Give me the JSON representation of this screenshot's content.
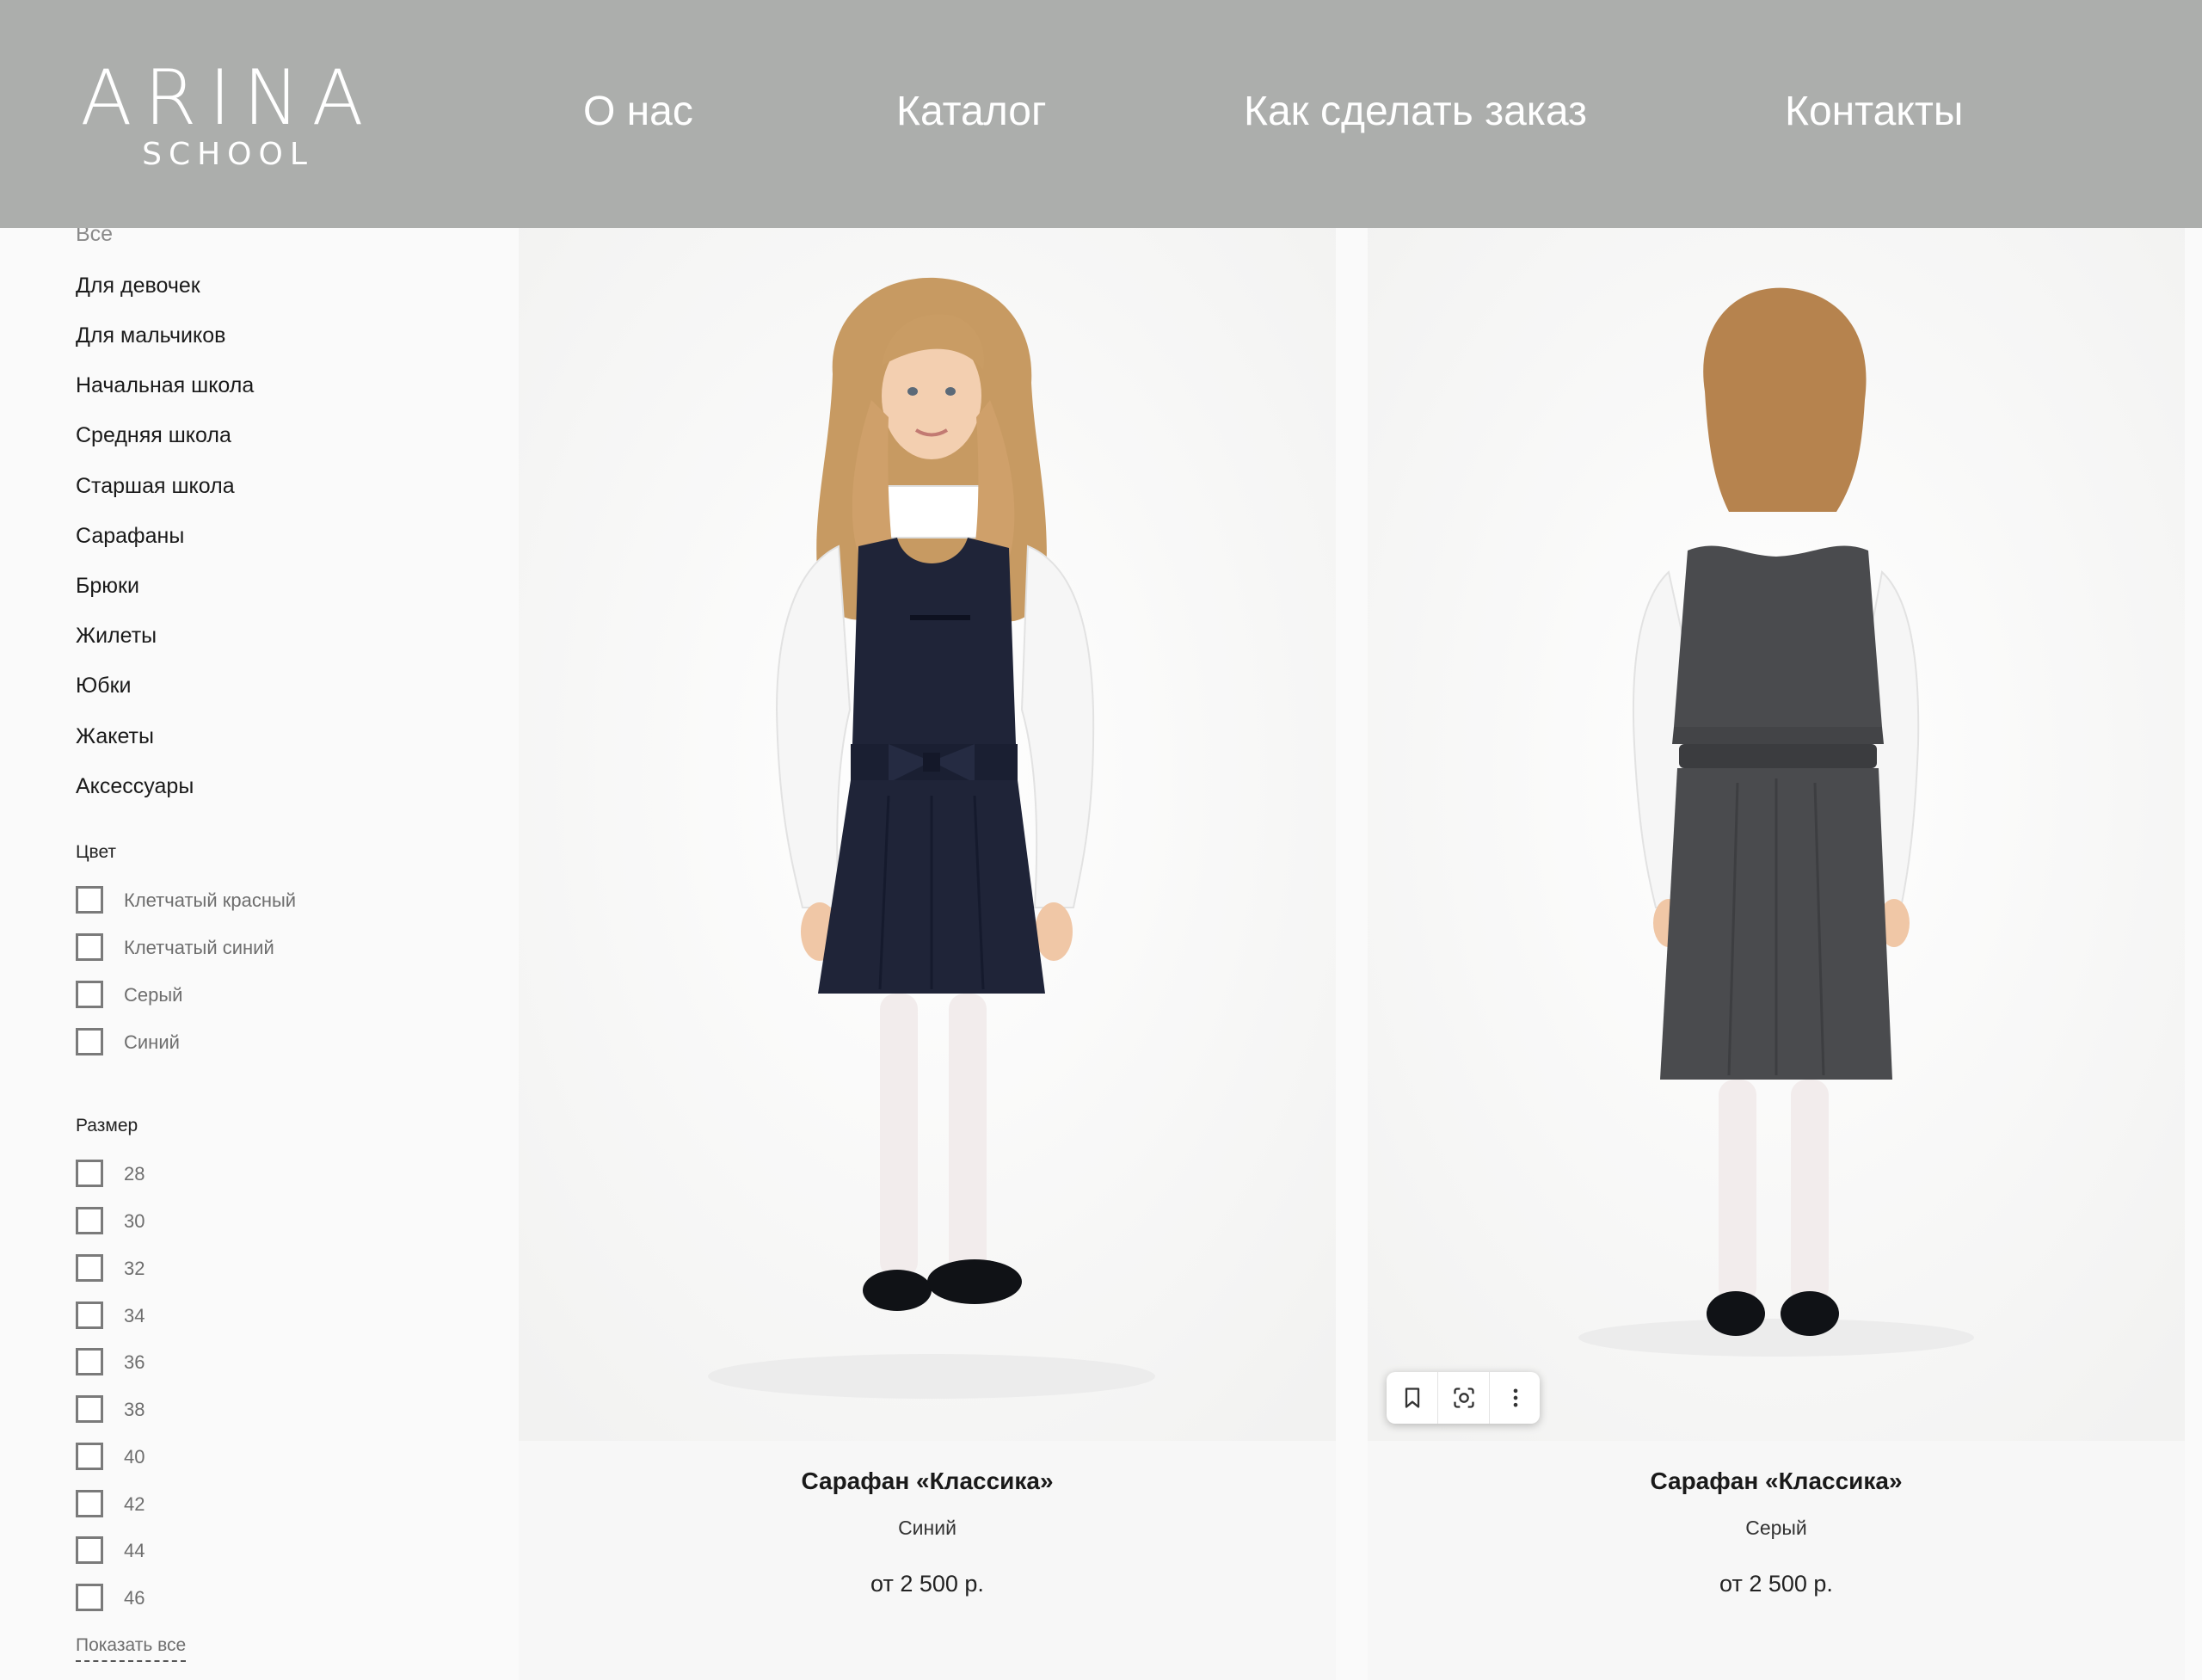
{
  "header": {
    "logo_main": "ARINA",
    "logo_sub": "SCHOOL",
    "nav": [
      {
        "label": "О нас"
      },
      {
        "label": "Каталог"
      },
      {
        "label": "Как сделать заказ"
      },
      {
        "label": "Контакты"
      }
    ]
  },
  "sidebar": {
    "categories": [
      {
        "label": "Все"
      },
      {
        "label": "Для девочек"
      },
      {
        "label": "Для мальчиков"
      },
      {
        "label": "Начальная школа"
      },
      {
        "label": "Средняя школа"
      },
      {
        "label": "Старшая школа"
      },
      {
        "label": "Сарафаны"
      },
      {
        "label": "Брюки"
      },
      {
        "label": "Жилеты"
      },
      {
        "label": "Юбки"
      },
      {
        "label": "Жакеты"
      },
      {
        "label": "Аксессуары"
      }
    ],
    "color_filter": {
      "title": "Цвет",
      "options": [
        {
          "label": "Клетчатый красный"
        },
        {
          "label": "Клетчатый синий"
        },
        {
          "label": "Серый"
        },
        {
          "label": "Синий"
        }
      ]
    },
    "size_filter": {
      "title": "Размер",
      "options": [
        {
          "label": "28"
        },
        {
          "label": "30"
        },
        {
          "label": "32"
        },
        {
          "label": "34"
        },
        {
          "label": "36"
        },
        {
          "label": "38"
        },
        {
          "label": "40"
        },
        {
          "label": "42"
        },
        {
          "label": "44"
        },
        {
          "label": "46"
        }
      ]
    },
    "show_all": "Показать все"
  },
  "products": [
    {
      "title": "Сарафан «Классика»",
      "color": "Синий",
      "price": "от 2 500 р.",
      "image": "girl-front-navy-dress"
    },
    {
      "title": "Сарафан «Классика»",
      "color": "Серый",
      "price": "от 2 500 р.",
      "image": "girl-back-gray-dress"
    }
  ],
  "image_tools": [
    {
      "icon": "bookmark-icon"
    },
    {
      "icon": "visual-search-icon"
    },
    {
      "icon": "more-vertical-icon"
    }
  ],
  "colors": {
    "header_bg": "#acaeac",
    "navy_dress": "#1f2438",
    "gray_dress": "#4a4b4e"
  }
}
